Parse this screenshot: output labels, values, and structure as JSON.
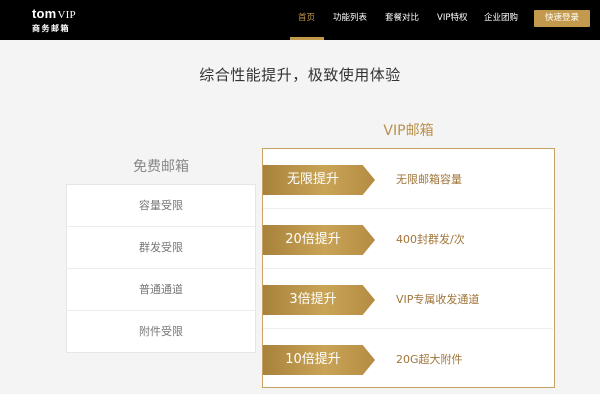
{
  "header": {
    "logo_main": "tom",
    "logo_vip": "VIP",
    "logo_sub": "商务邮箱",
    "nav": [
      {
        "label": "首页",
        "active": true
      },
      {
        "label": "功能列表",
        "active": false
      },
      {
        "label": "套餐对比",
        "active": false
      },
      {
        "label": "VIP特权",
        "active": false
      },
      {
        "label": "企业团购",
        "active": false
      }
    ],
    "login_label": "快速登录"
  },
  "headline": "综合性能提升，极致使用体验",
  "free": {
    "title": "免费邮箱",
    "items": [
      "容量受限",
      "群发受限",
      "普通通道",
      "附件受限"
    ]
  },
  "vip": {
    "title": "VIP邮箱",
    "items": [
      {
        "badge": "无限提升",
        "desc": "无限邮箱容量"
      },
      {
        "badge": "20倍提升",
        "desc": "400封群发/次"
      },
      {
        "badge": "3倍提升",
        "desc": "VIP专属收发通道"
      },
      {
        "badge": "10倍提升",
        "desc": "20G超大附件"
      }
    ]
  },
  "colors": {
    "accent": "#c19a4c",
    "header_bg": "#000000",
    "page_bg": "#f4f4f4",
    "vip_text": "#a0753a"
  }
}
